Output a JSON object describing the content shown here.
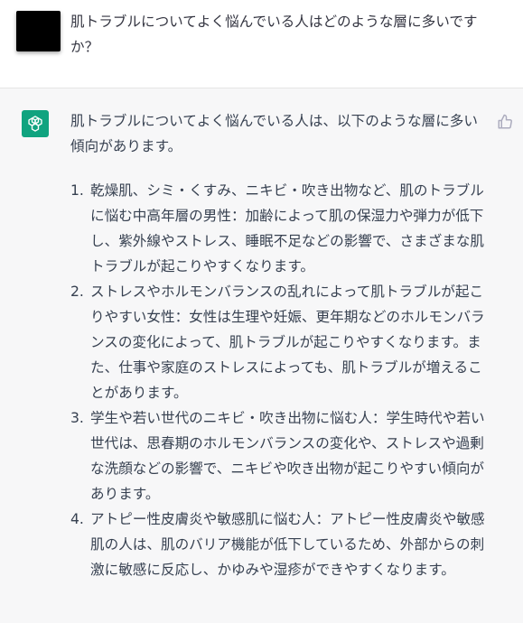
{
  "user": {
    "message": "肌トラブルについてよく悩んでいる人はどのような層に多いですか？"
  },
  "assistant": {
    "avatar_icon": "openai-logo-icon",
    "avatar_color": "#10a37f",
    "feedback_icon": "thumbs-up-icon",
    "intro": "肌トラブルについてよく悩んでいる人は、以下のような層に多い傾向があります。",
    "items": [
      {
        "number": "1.",
        "text": "乾燥肌、シミ・くすみ、ニキビ・吹き出物など、肌のトラブルに悩む中高年層の男性：加齢によって肌の保湿力や弾力が低下し、紫外線やストレス、睡眠不足などの影響で、さまざまな肌トラブルが起こりやすくなります。"
      },
      {
        "number": "2.",
        "text": "ストレスやホルモンバランスの乱れによって肌トラブルが起こりやすい女性：女性は生理や妊娠、更年期などのホルモンバランスの変化によって、肌トラブルが起こりやすくなります。また、仕事や家庭のストレスによっても、肌トラブルが増えることがあります。"
      },
      {
        "number": "3.",
        "text": "学生や若い世代のニキビ・吹き出物に悩む人：学生時代や若い世代は、思春期のホルモンバランスの変化や、ストレスや過剰な洗顔などの影響で、ニキビや吹き出物が起こりやすい傾向があります。"
      },
      {
        "number": "4.",
        "text": "アトピー性皮膚炎や敏感肌に悩む人：アトピー性皮膚炎や敏感肌の人は、肌のバリア機能が低下しているため、外部からの刺激に敏感に反応し、かゆみや湿疹ができやすくなります。"
      }
    ]
  }
}
